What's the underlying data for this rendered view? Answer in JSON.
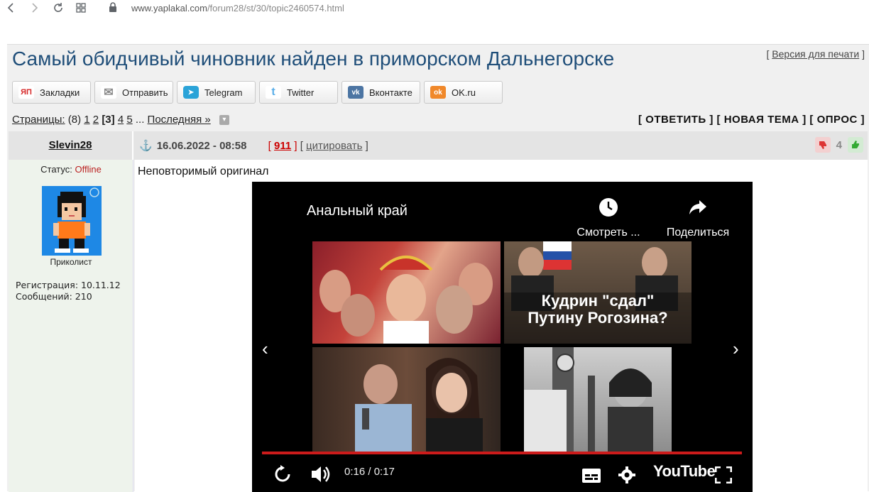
{
  "browser": {
    "url_host": "www.yaplakal.com",
    "url_path": "/forum28/st/30/topic2460574.html"
  },
  "topic": {
    "title": "Самый обидчивый чиновник найден в приморском Дальнегорске",
    "print_open": "[ ",
    "print_label": "Версия для печати",
    "print_close": " ]"
  },
  "share": {
    "buttons": [
      {
        "label": "Закладки",
        "icon": "yp-icon",
        "icon_text": "ЯП",
        "color": "#d62828"
      },
      {
        "label": "Отправить",
        "icon": "mail-icon",
        "icon_text": "✉",
        "color": "#999999"
      },
      {
        "label": "Telegram",
        "icon": "telegram-icon",
        "icon_text": "➤",
        "color": "#2aa3d8"
      },
      {
        "label": "Twitter",
        "icon": "twitter-icon",
        "icon_text": "t",
        "color": "#5aaee8"
      },
      {
        "label": "Вконтакте",
        "icon": "vk-icon",
        "icon_text": "vk",
        "color": "#4c75a3"
      },
      {
        "label": "OK.ru",
        "icon": "ok-icon",
        "icon_text": "ok",
        "color": "#f0882a"
      }
    ]
  },
  "pagination": {
    "label": "Страницы:",
    "count": "(8)",
    "p1": "1",
    "p2": "2",
    "current": "[3]",
    "p4": "4",
    "p5": "5",
    "ellipsis": "...",
    "last": "Последняя »"
  },
  "actions": {
    "reply": "[ ОТВЕТИТЬ ]",
    "new_topic": "[ НОВАЯ ТЕМА ]",
    "poll": "[ ОПРОС ]"
  },
  "post": {
    "author": "Slevin28",
    "datetime": "16.06.2022 - 08:58",
    "votes": "911",
    "quote": "цитировать",
    "rating": "4",
    "status_label": "Статус:",
    "status_value": "Offline",
    "rank": "Приколист",
    "registration": "Регистрация: 10.11.12",
    "messages": "Сообщений: 210",
    "text": "Неповторимый оригинал"
  },
  "video": {
    "title": "Анальный край",
    "watch_label": "Смотреть ...",
    "share_label": "Поделиться",
    "thumb2_caption_1": "Кудрин \"сдал\"",
    "thumb2_caption_2": "Путину Рогозина?",
    "time": "0:16 / 0:17",
    "brand": "YouTube",
    "progress_percent": 94
  }
}
